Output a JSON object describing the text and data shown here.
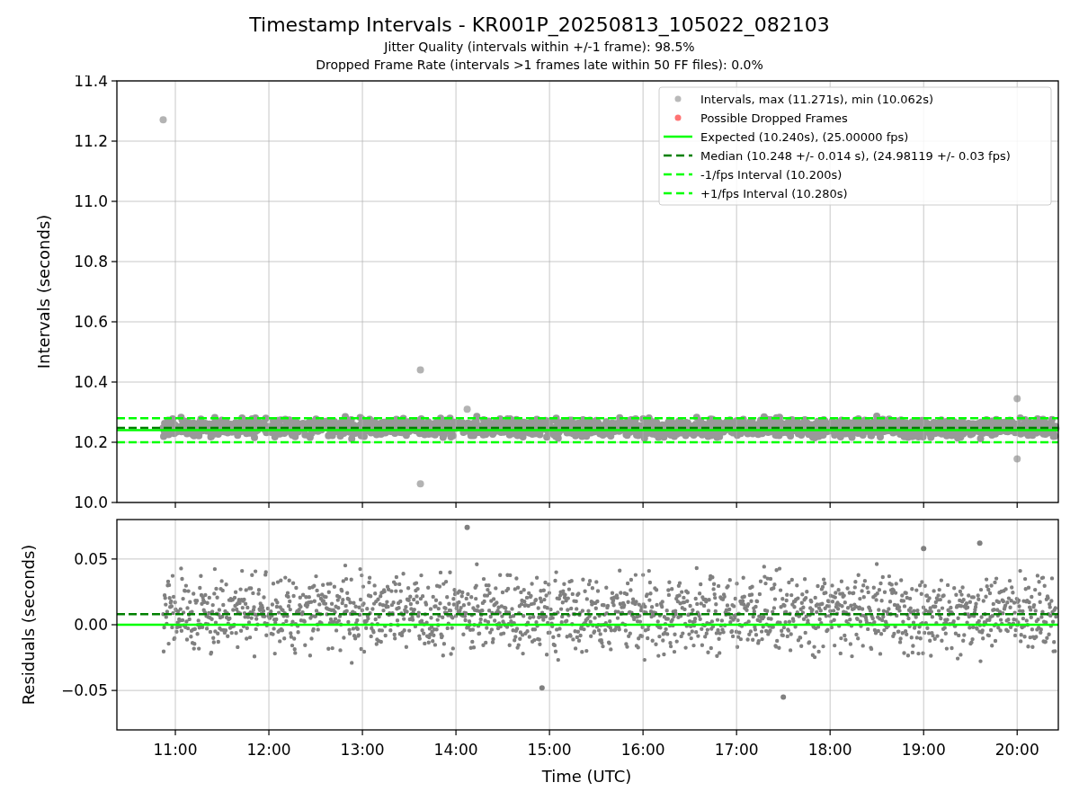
{
  "figure": {
    "title": "Timestamp Intervals - KR001P_20250813_105022_082103",
    "subtitles": [
      "Jitter Quality (intervals within +/-1 frame): 98.5%",
      "Dropped Frame Rate (intervals >1 frames late within 50 FF files): 0.0%"
    ]
  },
  "intervals_panel": {
    "chart_data": {
      "type": "scatter",
      "ylabel": "Intervals (seconds)",
      "xlim": [
        10.375,
        20.44
      ],
      "ylim": [
        10.0,
        11.4
      ],
      "grid": true,
      "legend": true,
      "yticks": [
        {
          "value": 10.0,
          "label": "10.0"
        },
        {
          "value": 10.2,
          "label": "10.2"
        },
        {
          "value": 10.4,
          "label": "10.4"
        },
        {
          "value": 10.6,
          "label": "10.6"
        },
        {
          "value": 10.8,
          "label": "10.8"
        },
        {
          "value": 11.0,
          "label": "11.0"
        },
        {
          "value": 11.2,
          "label": "11.2"
        },
        {
          "value": 11.4,
          "label": "11.4"
        }
      ],
      "series": [
        {
          "name": "Intervals, max (11.271s), min (10.062s)",
          "type": "scatter",
          "color": "#808080",
          "x": [
            10.87,
            13.62,
            13.62,
            14.12,
            20.0,
            20.0
          ],
          "values": [
            11.271,
            10.44,
            10.062,
            10.31,
            10.345,
            10.145
          ]
        },
        {
          "name": "Possible Dropped Frames",
          "type": "scatter",
          "color": "#ff0000"
        },
        {
          "name": "Expected (10.240s), (25.00000 fps)",
          "type": "line",
          "line_style": "solid",
          "color": "#00ff00",
          "x": [
            10.375,
            20.44
          ],
          "values": [
            10.24,
            10.24
          ]
        },
        {
          "name": "Median (10.248 +/- 0.014 s), (24.98119 +/- 0.03 fps)",
          "type": "line",
          "line_style": "dashed",
          "color": "#008000",
          "x": [
            10.375,
            20.44
          ],
          "values": [
            10.248,
            10.248
          ]
        },
        {
          "name": "-1/fps Interval (10.200s)",
          "type": "line",
          "line_style": "dashed",
          "color": "#00ff00",
          "x": [
            10.375,
            20.44
          ],
          "values": [
            10.2,
            10.2
          ]
        },
        {
          "name": "+1/fps Interval (10.280s)",
          "type": "line",
          "line_style": "dashed",
          "color": "#00ff00",
          "x": [
            10.375,
            20.44
          ],
          "values": [
            10.28,
            10.28
          ]
        }
      ]
    }
  },
  "residuals_panel": {
    "chart_data": {
      "type": "scatter",
      "xlabel": "Time (UTC)",
      "ylabel": "Residuals (seconds)",
      "xlim": [
        10.375,
        20.44
      ],
      "ylim": [
        -0.08,
        0.08
      ],
      "grid": true,
      "xticks": [
        {
          "value": 11,
          "label": "11:00"
        },
        {
          "value": 12,
          "label": "12:00"
        },
        {
          "value": 13,
          "label": "13:00"
        },
        {
          "value": 14,
          "label": "14:00"
        },
        {
          "value": 15,
          "label": "15:00"
        },
        {
          "value": 16,
          "label": "16:00"
        },
        {
          "value": 17,
          "label": "17:00"
        },
        {
          "value": 18,
          "label": "18:00"
        },
        {
          "value": 19,
          "label": "19:00"
        },
        {
          "value": 20,
          "label": "20:00"
        }
      ],
      "yticks": [
        {
          "value": -0.05,
          "label": "−0.05"
        },
        {
          "value": 0.0,
          "label": "0.00"
        },
        {
          "value": 0.05,
          "label": "0.05"
        }
      ],
      "series": [
        {
          "type": "scatter",
          "color": "#808080",
          "x": [
            14.12,
            17.5,
            19.0,
            19.6,
            14.92
          ],
          "values": [
            0.074,
            -0.055,
            0.058,
            0.062,
            -0.048
          ]
        },
        {
          "type": "line",
          "line_style": "solid",
          "color": "#00ff00",
          "x": [
            10.375,
            20.44
          ],
          "values": [
            0.0,
            0.0
          ]
        },
        {
          "type": "line",
          "line_style": "dashed",
          "color": "#008000",
          "x": [
            10.375,
            20.44
          ],
          "values": [
            0.008,
            0.008
          ]
        }
      ]
    }
  }
}
